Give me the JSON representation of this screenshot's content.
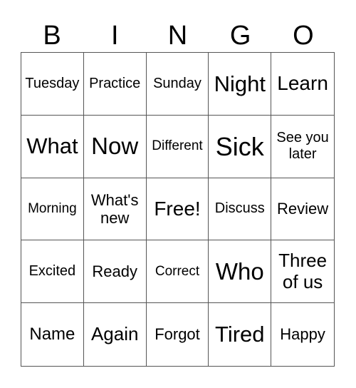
{
  "header": {
    "letters": [
      "B",
      "I",
      "N",
      "G",
      "O"
    ]
  },
  "cells": [
    [
      "Tuesday",
      "Practice",
      "Sunday",
      "Night",
      "Learn"
    ],
    [
      "What",
      "Now",
      "Different",
      "Sick",
      "See you later"
    ],
    [
      "Morning",
      "What's new",
      "Free!",
      "Discuss",
      "Review"
    ],
    [
      "Excited",
      "Ready",
      "Correct",
      "Who",
      "Three of us"
    ],
    [
      "Name",
      "Again",
      "Forgot",
      "Tired",
      "Happy"
    ]
  ]
}
